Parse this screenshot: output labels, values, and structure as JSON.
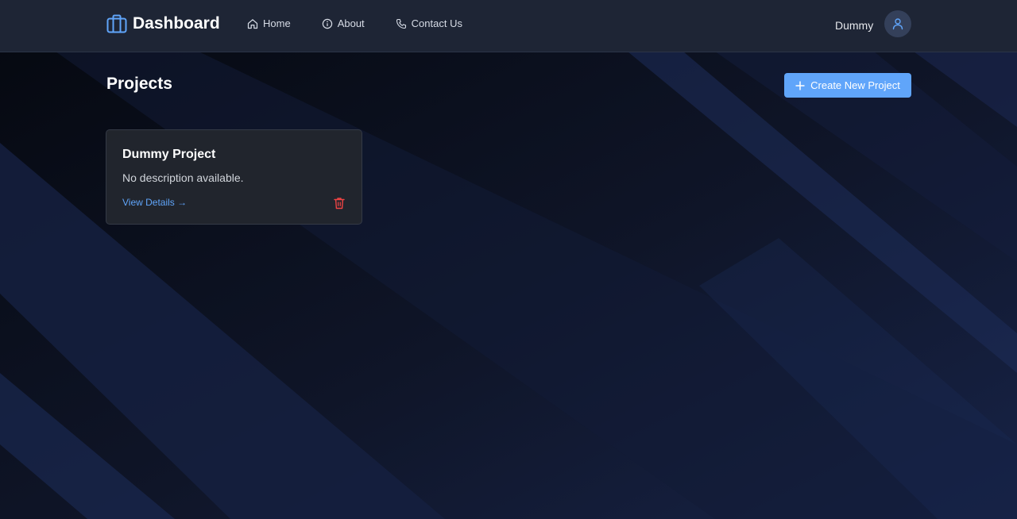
{
  "colors": {
    "accent": "#60a5fa",
    "navbar_bg": "#1e2535",
    "danger": "#ef4444",
    "card_bg": "#22262e"
  },
  "navbar": {
    "brand": "Dashboard",
    "brand_icon": "briefcase-icon",
    "links": [
      {
        "label": "Home",
        "icon": "home-icon"
      },
      {
        "label": "About",
        "icon": "info-icon"
      },
      {
        "label": "Contact Us",
        "icon": "phone-icon"
      }
    ],
    "user": {
      "name": "Dummy",
      "icon": "user-icon"
    }
  },
  "main": {
    "title": "Projects",
    "create_button": {
      "label": "Create New Project",
      "icon": "plus-icon"
    },
    "projects": [
      {
        "title": "Dummy Project",
        "description": "No description available.",
        "link_label": "View Details →",
        "delete_icon": "trash-icon"
      }
    ]
  }
}
